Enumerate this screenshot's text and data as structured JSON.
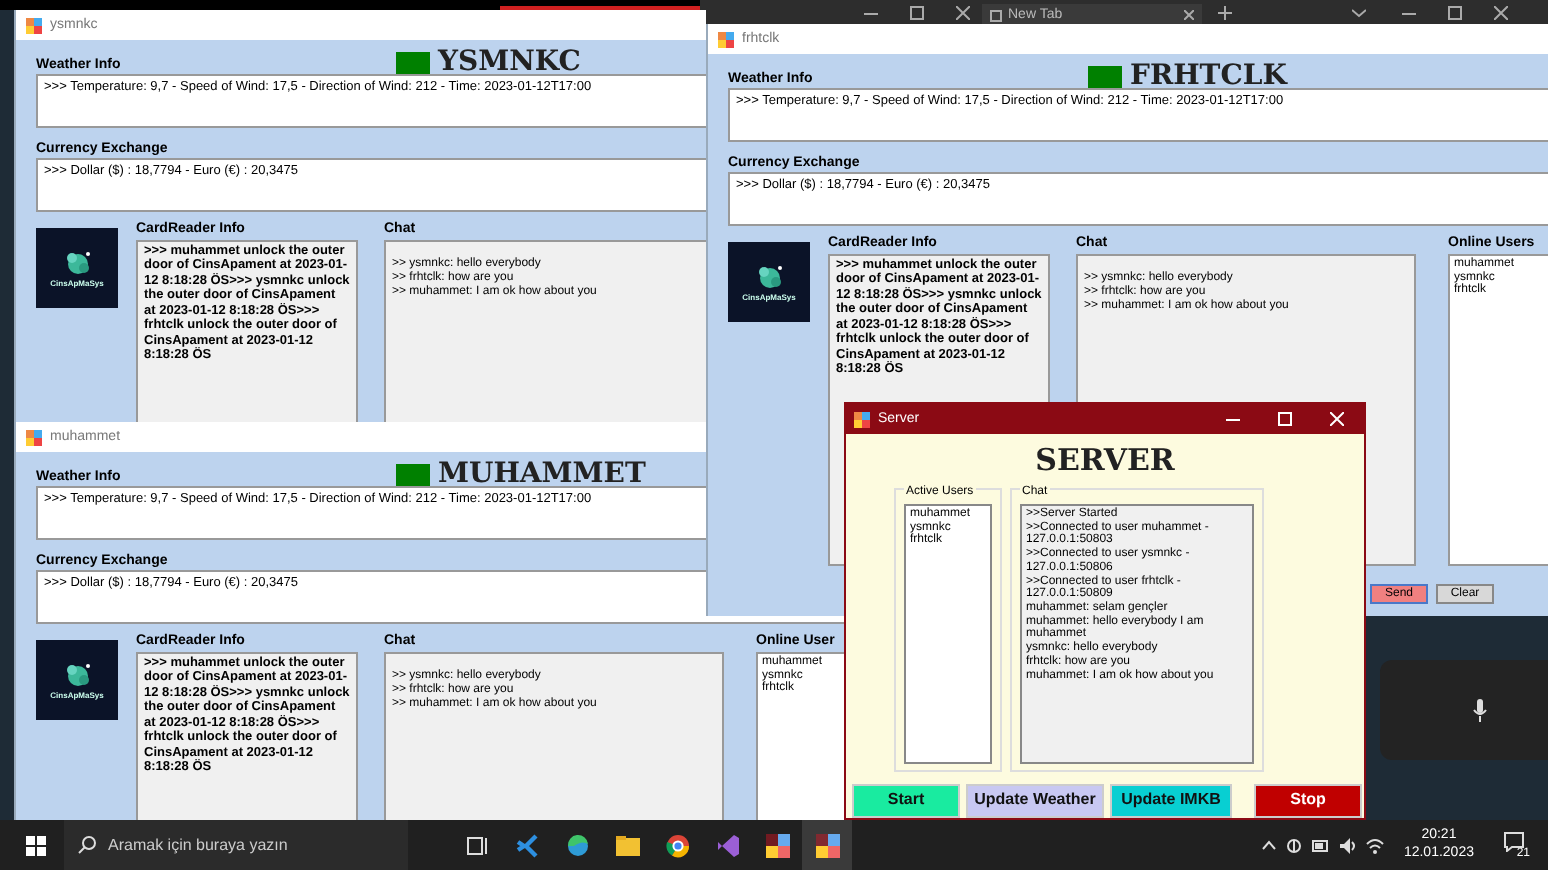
{
  "browser_bar": {
    "tab_title": "New Tab"
  },
  "client_windows": [
    {
      "title": "ysmnkc",
      "header": "YSMNKC",
      "weather_label": "Weather Info",
      "weather": ">>>  Temperature: 9,7 - Speed of Wind: 17,5 - Direction of Wind: 212 - Time: 2023-01-12T17:00",
      "currency_label": "Currency Exchange",
      "currency": ">>> Dollar ($) : 18,7794 - Euro (€) : 20,3475",
      "logo_text": "CinsApMaSys",
      "cardreader_label": "CardReader Info",
      "cardreader": ">>> muhammet unlock the outer door of CinsApament at 2023-01-12 8:18:28 ÖS>>> ysmnkc unlock the outer door of CinsApament at 2023-01-12 8:18:28 ÖS>>> frhtclk unlock the outer door of CinsApament at 2023-01-12 8:18:28 ÖS",
      "chat_label": "Chat",
      "chat": [
        ">> ysmnkc: hello everybody",
        ">> frhtclk: how are you",
        ">> muhammet: I am ok how about you"
      ]
    },
    {
      "title": "muhammet",
      "header": "MUHAMMET",
      "weather_label": "Weather Info",
      "weather": ">>>  Temperature: 9,7 - Speed of Wind: 17,5 - Direction of Wind: 212 - Time: 2023-01-12T17:00",
      "currency_label": "Currency Exchange",
      "currency": ">>> Dollar ($) : 18,7794 - Euro (€) : 20,3475",
      "logo_text": "CinsApMaSys",
      "cardreader_label": "CardReader Info",
      "cardreader": ">>> muhammet unlock the outer door of CinsApament at 2023-01-12 8:18:28 ÖS>>> ysmnkc unlock the outer door of CinsApament at 2023-01-12 8:18:28 ÖS>>> frhtclk unlock the outer door of CinsApament at 2023-01-12 8:18:28 ÖS",
      "chat_label": "Chat",
      "chat": [
        ">> ysmnkc: hello everybody",
        ">> frhtclk: how are you",
        ">> muhammet: I am ok how about you"
      ],
      "online_users_label": "Online User",
      "online_users": [
        "muhammet",
        "ysmnkc",
        "frhtclk"
      ]
    },
    {
      "title": "frhtclk",
      "header": "FRHTCLK",
      "weather_label": "Weather Info",
      "weather": ">>>  Temperature: 9,7 - Speed of Wind: 17,5 - Direction of Wind: 212 - Time: 2023-01-12T17:00",
      "currency_label": "Currency Exchange",
      "currency": ">>> Dollar ($) : 18,7794 - Euro (€) : 20,3475",
      "logo_text": "CinsApMaSys",
      "cardreader_label": "CardReader Info",
      "cardreader": ">>> muhammet unlock the outer door of CinsApament at 2023-01-12 8:18:28 ÖS>>> ysmnkc unlock the outer door of CinsApament at 2023-01-12 8:18:28 ÖS>>> frhtclk unlock the outer door of CinsApament at 2023-01-12 8:18:28 ÖS",
      "chat_label": "Chat",
      "chat": [
        ">> ysmnkc: hello everybody",
        ">> frhtclk: how are you",
        ">> muhammet: I am ok how about you"
      ],
      "online_users_label": "Online Users",
      "online_users": [
        "muhammet",
        "ysmnkc",
        "frhtclk"
      ],
      "buttons": [
        "Send",
        "Clear"
      ]
    }
  ],
  "server": {
    "title": "Server",
    "header": "SERVER",
    "active_users_label": "Active Users",
    "active_users": [
      "muhammet",
      "ysmnkc",
      "frhtclk"
    ],
    "chat_label": "Chat",
    "chat": [
      ">>Server Started",
      ">>Connected to user muhammet - 127.0.0.1:50803",
      ">>Connected to user ysmnkc - 127.0.0.1:50806",
      ">>Connected to user frhtclk - 127.0.0.1:50809",
      "muhammet: selam gençler",
      "muhammet: hello everybody I am muhammet",
      "ysmnkc: hello everybody",
      "frhtclk: how are you",
      "muhammet: I am ok how about you"
    ],
    "buttons": [
      {
        "label": "Start",
        "color": "#19eba0"
      },
      {
        "label": "Update Weather",
        "color": "#c8c8f2"
      },
      {
        "label": "Update IMKB",
        "color": "#08cfd2"
      },
      {
        "label": "Stop",
        "color": "#c00000"
      }
    ]
  },
  "taskbar": {
    "search_placeholder": "Aramak için buraya yazın",
    "time": "20:21",
    "date": "12.01.2023",
    "notification_count": "21"
  }
}
